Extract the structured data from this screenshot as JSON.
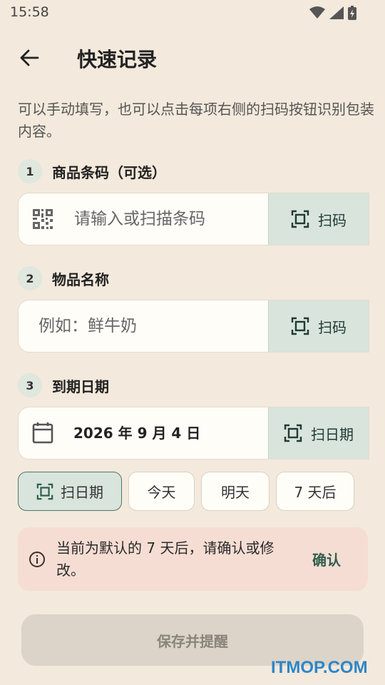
{
  "status": {
    "time": "15:58"
  },
  "header": {
    "title": "快速记录"
  },
  "hint": "可以手动填写，也可以点击每项右侧的扫码按钮识别包装内容。",
  "sections": [
    {
      "number": "1",
      "label": "商品条码（可选）",
      "placeholder": "请输入或扫描条码",
      "button": "扫码",
      "icon": "qr-code-icon"
    },
    {
      "number": "2",
      "label": "物品名称",
      "placeholder": "例如：鲜牛奶",
      "button": "扫码"
    },
    {
      "number": "3",
      "label": "到期日期",
      "value": "2026 年 9 月 4 日",
      "button": "扫日期",
      "icon": "calendar-icon"
    }
  ],
  "chips": [
    "扫日期",
    "今天",
    "明天",
    "7 天后"
  ],
  "notice": {
    "message": "当前为默认的 7 天后，请确认或修改。",
    "confirm": "确认"
  },
  "save_button": "保存并提醒",
  "watermark": "ITMOP.COM",
  "colors": {
    "background": "#f3e9dc",
    "accent": "#2f5e4e",
    "scan_bg": "#d8e4dc",
    "notice_bg": "#f6ddd4"
  }
}
